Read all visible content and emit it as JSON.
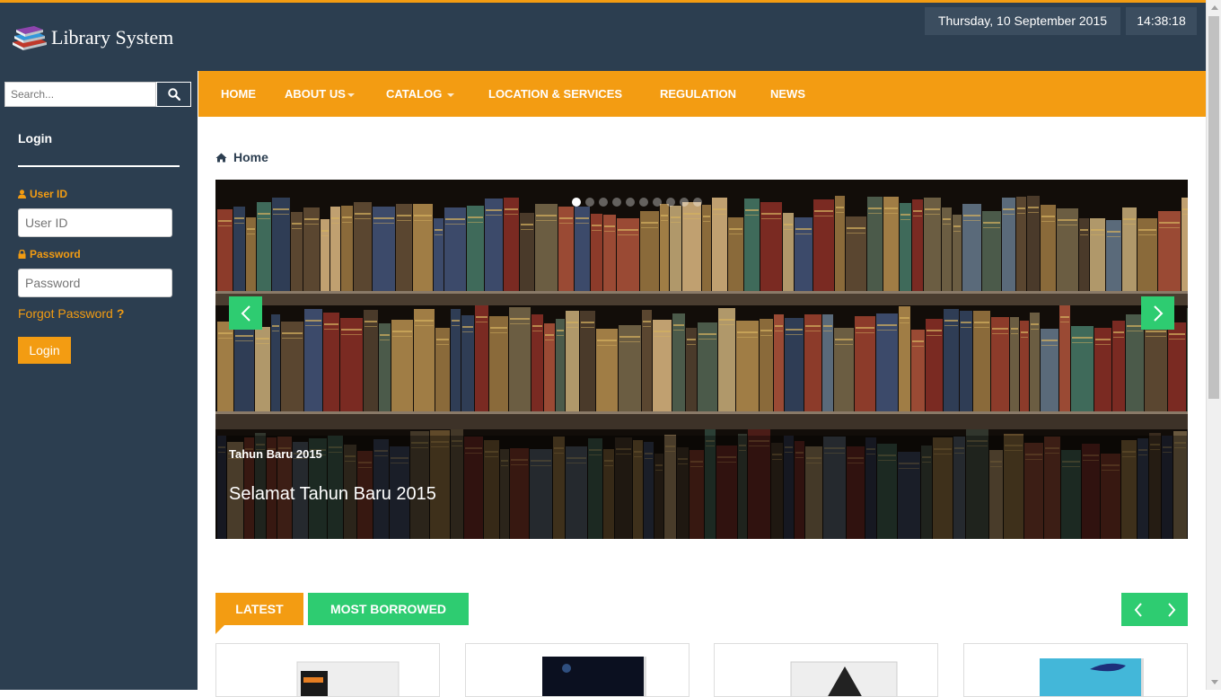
{
  "app": {
    "title": "Library System"
  },
  "header": {
    "date": "Thursday, 10 September 2015",
    "time": "14:38:18"
  },
  "search": {
    "placeholder": "Search..."
  },
  "login": {
    "title": "Login",
    "user_label": "User ID",
    "user_placeholder": "User ID",
    "password_label": "Password",
    "password_placeholder": "Password",
    "forgot": "Forgot Password",
    "forgot_mark": "?",
    "button": "Login"
  },
  "nav": [
    {
      "label": "HOME"
    },
    {
      "label": "ABOUT US",
      "dropdown": true
    },
    {
      "label": "CATALOG",
      "dropdown": true
    },
    {
      "label": "LOCATION & SERVICES"
    },
    {
      "label": "REGULATION"
    },
    {
      "label": "NEWS"
    }
  ],
  "breadcrumb": {
    "label": "Home",
    "icon": "home-icon"
  },
  "slider": {
    "subtitle": "Tahun Baru 2015",
    "title": "Selamat Tahun Baru 2015",
    "slide_count": 10,
    "active_slide": 1
  },
  "tabs": {
    "latest": "LATEST",
    "most_borrowed": "MOST BORROWED"
  },
  "colors": {
    "navy": "#2c3e50",
    "orange": "#f39c12",
    "green": "#2ecc71"
  }
}
